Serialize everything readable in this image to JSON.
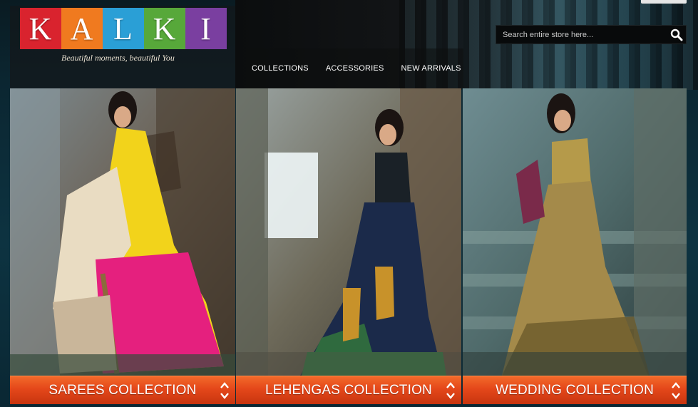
{
  "brand": {
    "logo_letters": [
      "K",
      "A",
      "L",
      "K",
      "I"
    ],
    "logo_tile_colors": [
      "#d9232e",
      "#f07a1f",
      "#2a9fd6",
      "#57a83a",
      "#7a3fa0"
    ],
    "tagline": "Beautiful moments, beautiful You"
  },
  "nav": {
    "items": [
      {
        "label": "COLLECTIONS"
      },
      {
        "label": "ACCESSORIES"
      },
      {
        "label": "NEW ARRIVALS"
      }
    ]
  },
  "search": {
    "placeholder": "Search entire store here...",
    "value": ""
  },
  "panels": [
    {
      "label": "SAREES COLLECTION",
      "icon": "expand-arrows-icon"
    },
    {
      "label": "LEHENGAS COLLECTION",
      "icon": "expand-arrows-icon"
    },
    {
      "label": "WEDDING COLLECTION",
      "icon": "expand-arrows-icon"
    }
  ],
  "colors": {
    "accent_orange": "#e4471a",
    "page_bg": "#0c2a38"
  }
}
